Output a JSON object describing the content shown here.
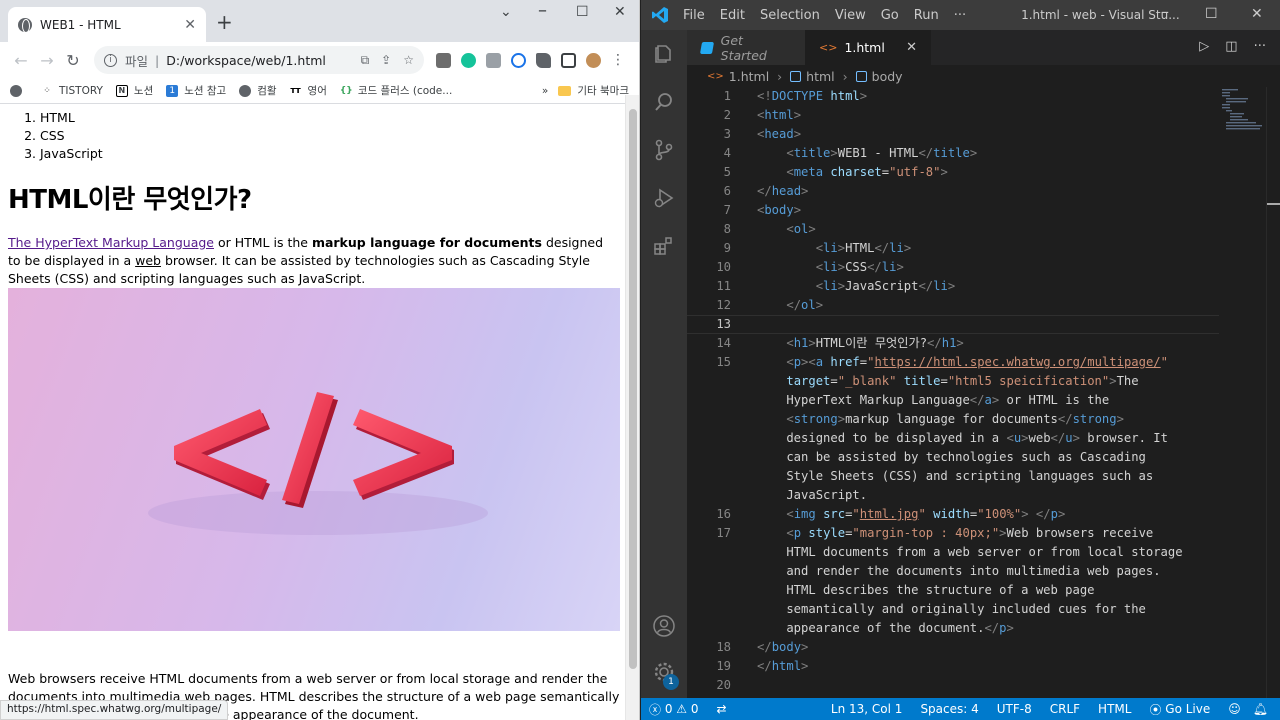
{
  "chrome": {
    "tab_title": "WEB1 - HTML",
    "address": {
      "scheme": "파일",
      "path": "D:/workspace/web/1.html"
    },
    "bookmarks": [
      "TISTORY",
      "노션",
      "노션 참고",
      "컴활",
      "영어",
      "코드 플러스 (code..."
    ],
    "bookmarks_overflow": "»",
    "other_bookmarks": "기타 북마크",
    "status_url": "https://html.spec.whatwg.org/multipage/"
  },
  "page": {
    "list": [
      "HTML",
      "CSS",
      "JavaScript"
    ],
    "heading": "HTML이란 무엇인가?",
    "intro": {
      "link": "The HyperText Markup Language",
      "t1": " or HTML is the ",
      "strong": "markup language for documents",
      "t2": " designed to be displayed in a ",
      "u": "web",
      "t3": " browser. It can be assisted by technologies such as Cascading Style Sheets (CSS) and scripting languages such as JavaScript."
    },
    "after": "Web browsers receive HTML documents from a web server or from local storage and render the documents into multimedia web pages. HTML describes the structure of a web page semantically and originally included cues for the appearance of the document."
  },
  "vscode": {
    "menu": [
      "File",
      "Edit",
      "Selection",
      "View",
      "Go",
      "Run",
      "···"
    ],
    "window_title": "1.html - web - Visual Stu...",
    "tabs": [
      {
        "label": "Get Started"
      },
      {
        "label": "1.html"
      }
    ],
    "breadcrumb": [
      "1.html",
      "html",
      "body"
    ],
    "line_numbers": [
      "1",
      "2",
      "3",
      "4",
      "5",
      "6",
      "7",
      "8",
      "9",
      "10",
      "11",
      "12",
      "13",
      "14",
      "15",
      "",
      "",
      "",
      "",
      "",
      "",
      "",
      "16",
      "17",
      "",
      "",
      "",
      "",
      "",
      "18",
      "19",
      "20"
    ],
    "status": {
      "errors": "0",
      "warnings": "0",
      "position": "Ln 13, Col 1",
      "spaces": "Spaces: 4",
      "encoding": "UTF-8",
      "eol": "CRLF",
      "language": "HTML",
      "golive": "Go Live"
    },
    "badge": "1"
  },
  "colors": {
    "vscode_accent": "#007acc",
    "tag": "#569cd6",
    "attr": "#9cdcfe",
    "string": "#ce9178",
    "link_visited": "#551a8b"
  }
}
